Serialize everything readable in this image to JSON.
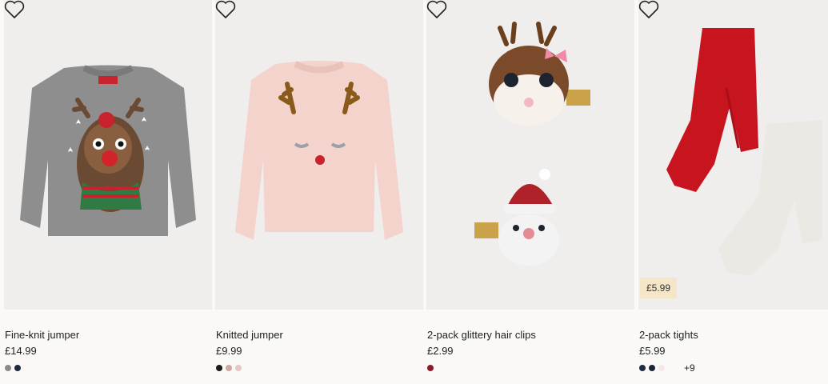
{
  "products": [
    {
      "name": "Fine-knit jumper",
      "price": "£14.99",
      "image": "grey-reindeer-jumper",
      "swatches": [
        "#8a8a8a",
        "#1e2a3a"
      ],
      "more": ""
    },
    {
      "name": "Knitted jumper",
      "price": "£9.99",
      "image": "pink-reindeer-jumper",
      "swatches": [
        "#1b1b1b",
        "#c9a9a0",
        "#e6c8c0"
      ],
      "more": ""
    },
    {
      "name": "2-pack glittery hair clips",
      "price": "£2.99",
      "image": "reindeer-and-santa-hair-clips",
      "swatches": [
        "#8b1a2b"
      ],
      "more": ""
    },
    {
      "name": "2-pack tights",
      "price": "£5.99",
      "image": "red-and-cream-tights",
      "badge": "£5.99",
      "swatches": [
        "#1f2b45",
        "#1c2536",
        "#f6e5ea"
      ],
      "more": "+9"
    }
  ],
  "icons": {
    "favourite": "heart-outline-icon"
  },
  "colors": {
    "page_bg": "#faf9f8",
    "image_bg": "#efeeed",
    "badge_bg": "#f5e6c8"
  }
}
